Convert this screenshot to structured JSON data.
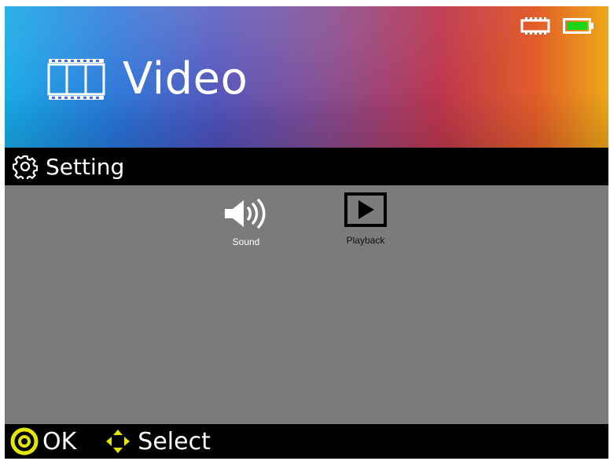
{
  "header": {
    "title": "Video",
    "title_icon": "film-icon",
    "status_icons": [
      "sd-card-icon",
      "battery-icon"
    ],
    "battery_level": 1.0,
    "battery_color": "#19d619"
  },
  "setting_bar": {
    "label": "Setting",
    "icon": "gear-icon"
  },
  "menu": {
    "items": [
      {
        "label": "Sound",
        "icon": "speaker-icon"
      },
      {
        "label": "Playback",
        "icon": "play-icon"
      }
    ]
  },
  "bottom_bar": {
    "ok_label": "OK",
    "select_label": "Select",
    "accent_color": "#e3e600"
  }
}
